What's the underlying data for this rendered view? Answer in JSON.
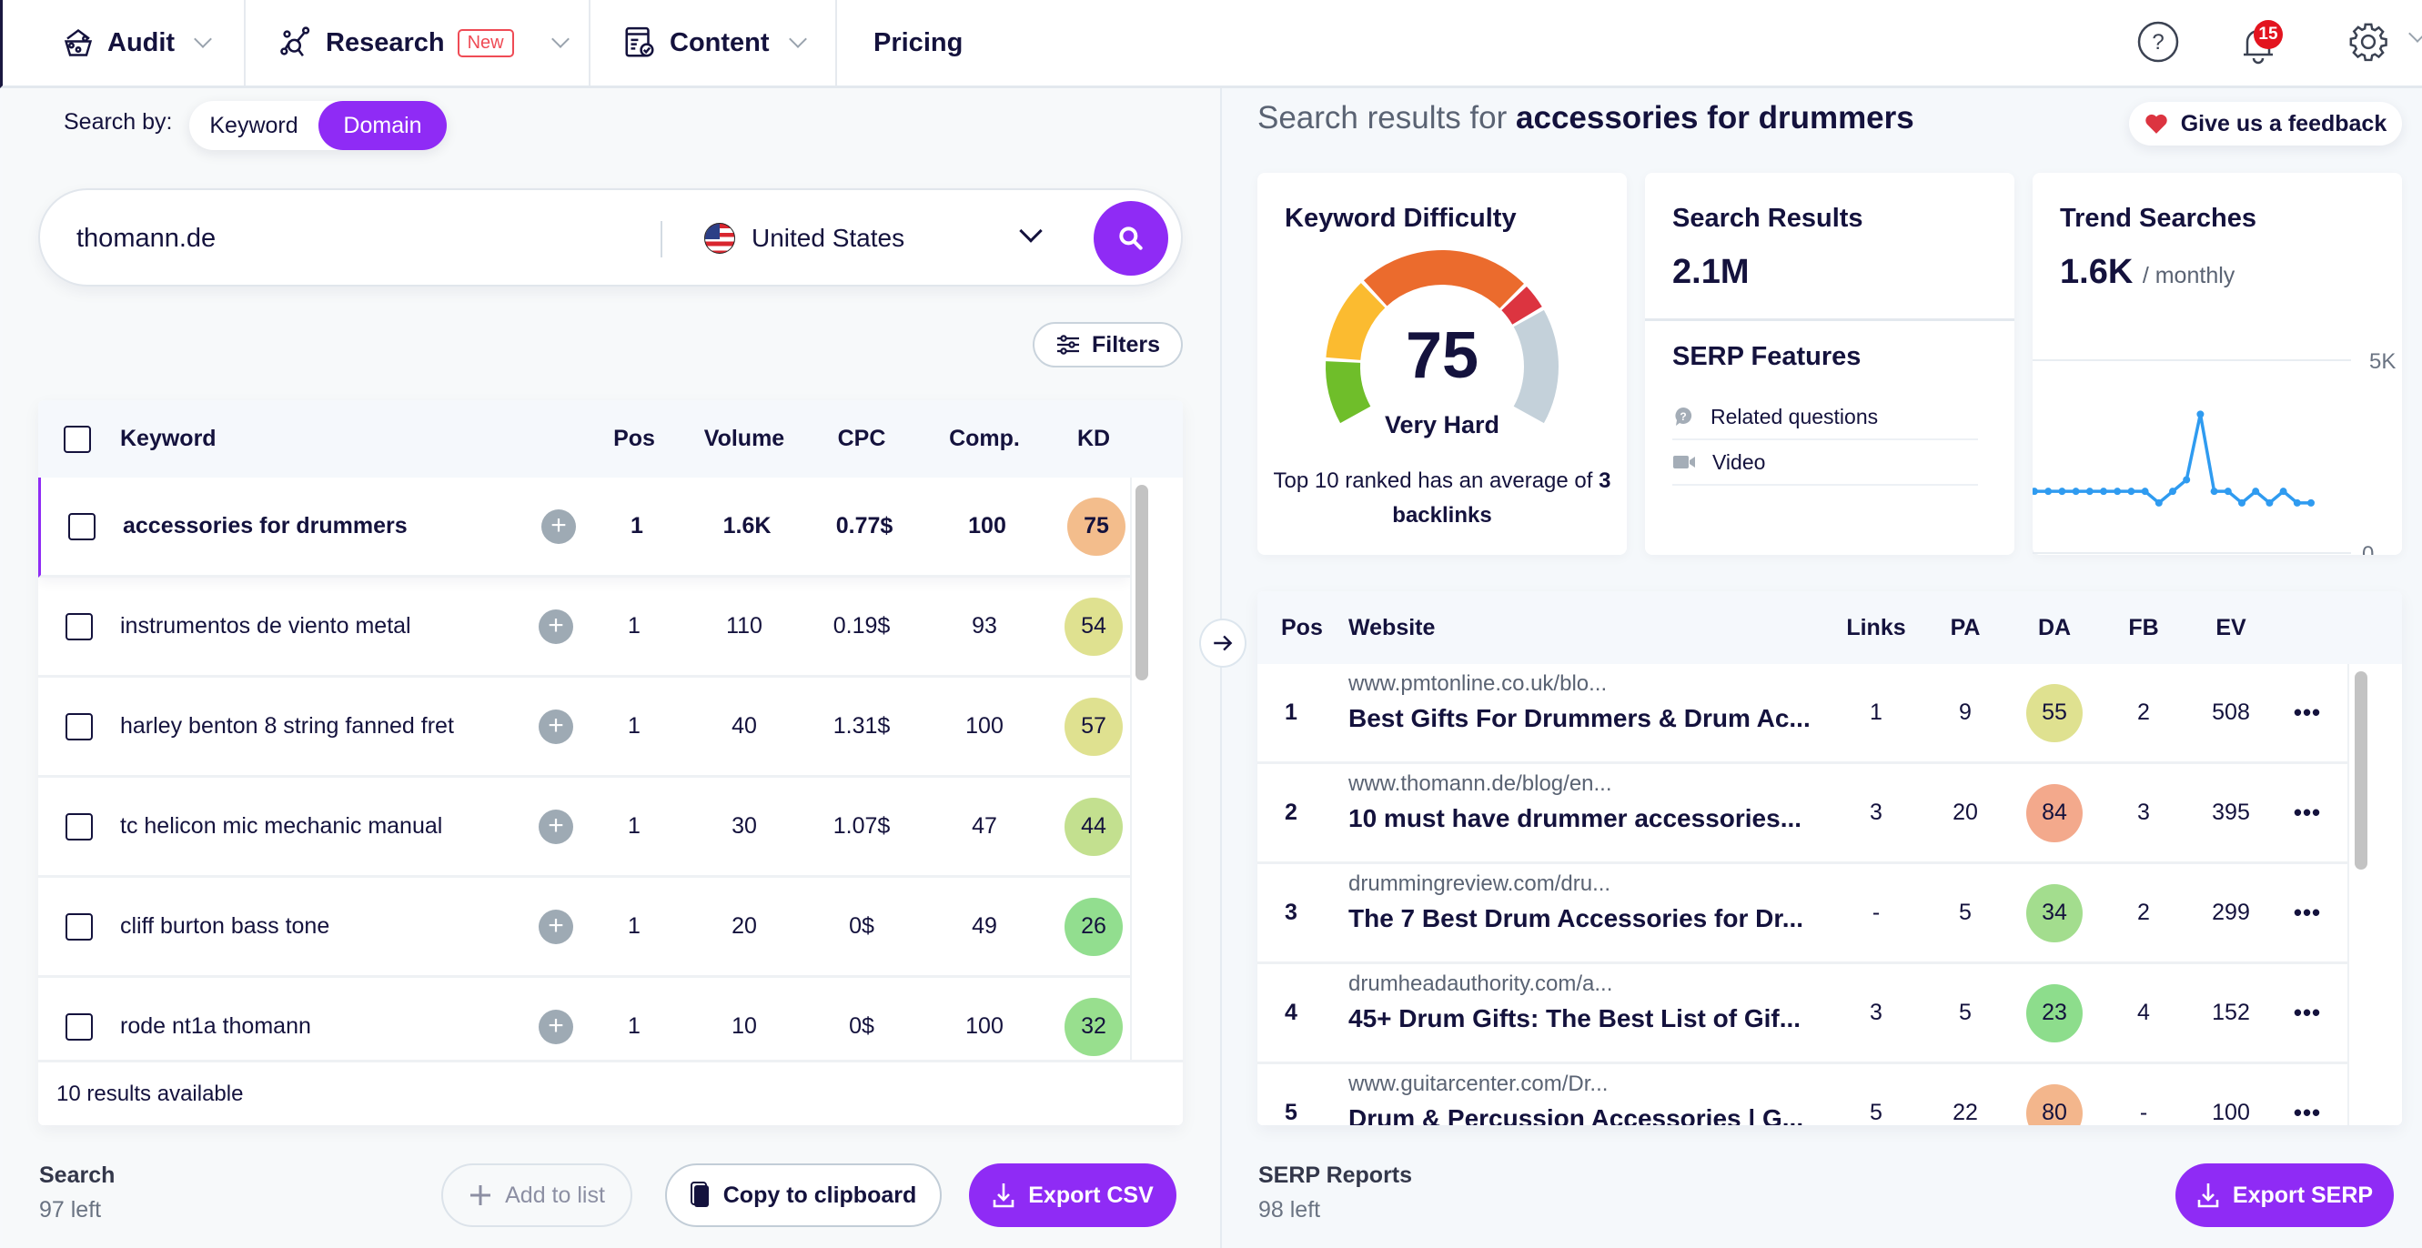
{
  "nav": {
    "items": [
      {
        "label": "Audit",
        "icon": "audit-icon",
        "has_dropdown": true
      },
      {
        "label": "Research",
        "icon": "research-icon",
        "badge": "New",
        "has_dropdown": true
      },
      {
        "label": "Content",
        "icon": "content-icon",
        "has_dropdown": true
      },
      {
        "label": "Pricing"
      }
    ],
    "notifications_count": "15",
    "icons": [
      "help-icon",
      "bell-icon",
      "gear-icon"
    ]
  },
  "search": {
    "by_label": "Search by:",
    "modes": [
      "Keyword",
      "Domain"
    ],
    "active_mode": "Domain",
    "query": "thomann.de",
    "country": "United States",
    "filters_label": "Filters"
  },
  "keywords_table": {
    "columns": [
      "Keyword",
      "Pos",
      "Volume",
      "CPC",
      "Comp.",
      "KD"
    ],
    "rows": [
      {
        "keyword": "accessories for drummers",
        "pos": "1",
        "volume": "1.6K",
        "cpc": "0.77$",
        "comp": "100",
        "kd": "75",
        "kd_color": "#f3bd8c",
        "active": true
      },
      {
        "keyword": "instrumentos de viento metal",
        "pos": "1",
        "volume": "110",
        "cpc": "0.19$",
        "comp": "93",
        "kd": "54",
        "kd_color": "#dfe190"
      },
      {
        "keyword": "harley benton 8 string fanned fret",
        "pos": "1",
        "volume": "40",
        "cpc": "1.31$",
        "comp": "100",
        "kd": "57",
        "kd_color": "#dfe190"
      },
      {
        "keyword": "tc helicon mic mechanic manual",
        "pos": "1",
        "volume": "30",
        "cpc": "1.07$",
        "comp": "47",
        "kd": "44",
        "kd_color": "#c3e08f"
      },
      {
        "keyword": "cliff burton bass tone",
        "pos": "1",
        "volume": "20",
        "cpc": "0$",
        "comp": "49",
        "kd": "26",
        "kd_color": "#92de8f"
      },
      {
        "keyword": "rode nt1a thomann",
        "pos": "1",
        "volume": "10",
        "cpc": "0$",
        "comp": "100",
        "kd": "32",
        "kd_color": "#98df8e"
      }
    ],
    "footer": "10 results available"
  },
  "left_bottom": {
    "quota_title": "Search",
    "quota_left": "97 left",
    "add_to_list": "Add to list",
    "copy": "Copy to clipboard",
    "export": "Export CSV"
  },
  "results": {
    "title_prefix": "Search results for",
    "keyword": "accessories for drummers",
    "feedback": "Give us a feedback"
  },
  "kd_card": {
    "title": "Keyword Difficulty",
    "value": "75",
    "label": "Very Hard",
    "note_prefix": "Top 10 ranked has an average of",
    "note_value": "3",
    "note_suffix": "backlinks",
    "score": 75,
    "colors": {
      "green": "#6fbe2a",
      "yellow": "#fbbb30",
      "orange": "#eb6b2d",
      "red": "#dc3440",
      "rest": "#c4d1da"
    }
  },
  "sr_card": {
    "title": "Search Results",
    "value": "2.1M",
    "serp_title": "SERP Features",
    "features": [
      {
        "label": "Related questions",
        "icon": "question-bubble-icon"
      },
      {
        "label": "Video",
        "icon": "video-icon"
      }
    ]
  },
  "trend_card": {
    "title": "Trend Searches",
    "value": "1.6K",
    "unit": "/ monthly"
  },
  "chart_data": {
    "type": "line",
    "title": "Trend Searches",
    "y_ticks": [
      "5K",
      "0"
    ],
    "ylim": [
      0,
      5000
    ],
    "grid": true,
    "color": "#2f9bf0",
    "values": [
      1600,
      1600,
      1600,
      1600,
      1600,
      1600,
      1600,
      1600,
      1600,
      1300,
      1600,
      1900,
      3600,
      1600,
      1600,
      1300,
      1600,
      1300,
      1600,
      1300,
      1300
    ]
  },
  "serp_table": {
    "columns": [
      "Pos",
      "Website",
      "Links",
      "PA",
      "DA",
      "FB",
      "EV"
    ],
    "rows": [
      {
        "pos": "1",
        "url": "www.pmtonline.co.uk/blo...",
        "title": "Best Gifts For Drummers & Drum Ac...",
        "links": "1",
        "pa": "9",
        "da": "55",
        "da_color": "#dfe190",
        "fb": "2",
        "ev": "508"
      },
      {
        "pos": "2",
        "url": "www.thomann.de/blog/en...",
        "title": "10 must have drummer accessories...",
        "links": "3",
        "pa": "20",
        "da": "84",
        "da_color": "#f3a98c",
        "fb": "3",
        "ev": "395"
      },
      {
        "pos": "3",
        "url": "drummingreview.com/dru...",
        "title": "The 7 Best Drum Accessories for Dr...",
        "links": "-",
        "pa": "5",
        "da": "34",
        "da_color": "#a3dd8e",
        "fb": "2",
        "ev": "299"
      },
      {
        "pos": "4",
        "url": "drumheadauthority.com/a...",
        "title": "45+ Drum Gifts: The Best List of Gif...",
        "links": "3",
        "pa": "5",
        "da": "23",
        "da_color": "#8ddd8c",
        "fb": "4",
        "ev": "152"
      },
      {
        "pos": "5",
        "url": "www.guitarcenter.com/Dr...",
        "title": "Drum & Percussion Accessories | G...",
        "links": "5",
        "pa": "22",
        "da": "80",
        "da_color": "#f3b68c",
        "fb": "-",
        "ev": "100"
      }
    ],
    "more_label": "•••"
  },
  "right_bottom": {
    "quota_title": "SERP Reports",
    "quota_left": "98 left",
    "export": "Export SERP"
  }
}
